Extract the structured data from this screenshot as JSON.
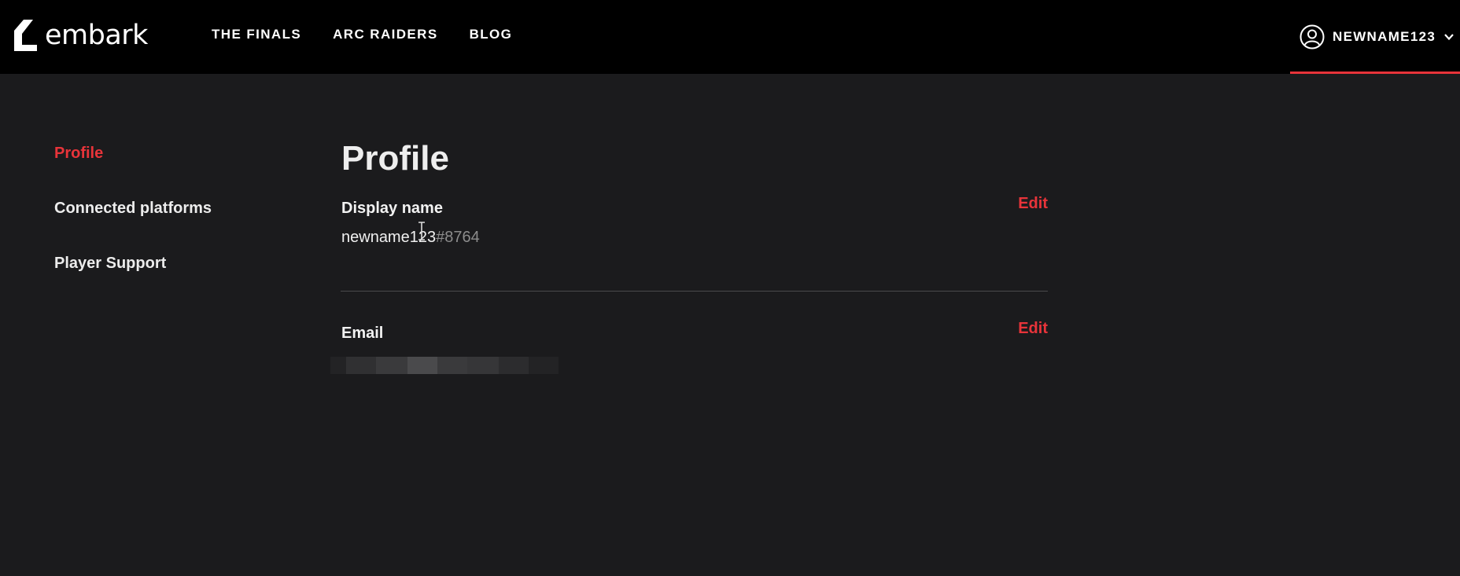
{
  "brand": {
    "name": "embark"
  },
  "nav": {
    "items": [
      "THE FINALS",
      "ARC RAIDERS",
      "BLOG"
    ]
  },
  "user": {
    "name": "NEWNAME123"
  },
  "sidebar": {
    "items": [
      {
        "label": "Profile",
        "active": true
      },
      {
        "label": "Connected platforms",
        "active": false
      },
      {
        "label": "Player Support",
        "active": false
      }
    ]
  },
  "main": {
    "title": "Profile",
    "display_name": {
      "label": "Display name",
      "edit_label": "Edit",
      "name": "newname123",
      "tag": "#8764"
    },
    "email": {
      "label": "Email",
      "edit_label": "Edit",
      "redacted": true
    }
  },
  "colors": {
    "accent": "#e8343a",
    "background": "#1b1b1d",
    "topbar": "#000000"
  }
}
